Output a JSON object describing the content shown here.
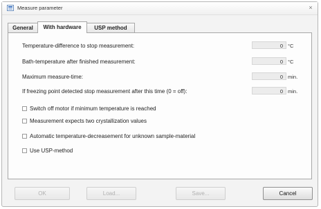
{
  "window": {
    "title": "Measure parameter",
    "close_symbol": "×"
  },
  "tabs": [
    {
      "label": "General",
      "active": false
    },
    {
      "label": "With hardware",
      "active": true
    },
    {
      "label": "USP method",
      "active": false
    }
  ],
  "fields": [
    {
      "label": "Temperature-difference to stop measurement:",
      "value": "0",
      "unit": "°C"
    },
    {
      "label": "Bath-temperature after finished measurement:",
      "value": "0",
      "unit": "°C"
    },
    {
      "label": "Maximum measure-time:",
      "value": "0",
      "unit": "min."
    },
    {
      "label": "If freezing point detected stop measurement after this time (0 = off):",
      "value": "0",
      "unit": "min."
    }
  ],
  "checkboxes": [
    {
      "label": "Switch off motor if minimum temperature is reached",
      "checked": false
    },
    {
      "label": "Measurement expects two crystallization values",
      "checked": false
    },
    {
      "label": "Automatic temperature-decreasement for unknown sample-material",
      "checked": false
    },
    {
      "label": "Use USP-method",
      "checked": false
    }
  ],
  "buttons": {
    "ok": "OK",
    "load": "Load...",
    "save": "Save...",
    "cancel": "Cancel"
  }
}
